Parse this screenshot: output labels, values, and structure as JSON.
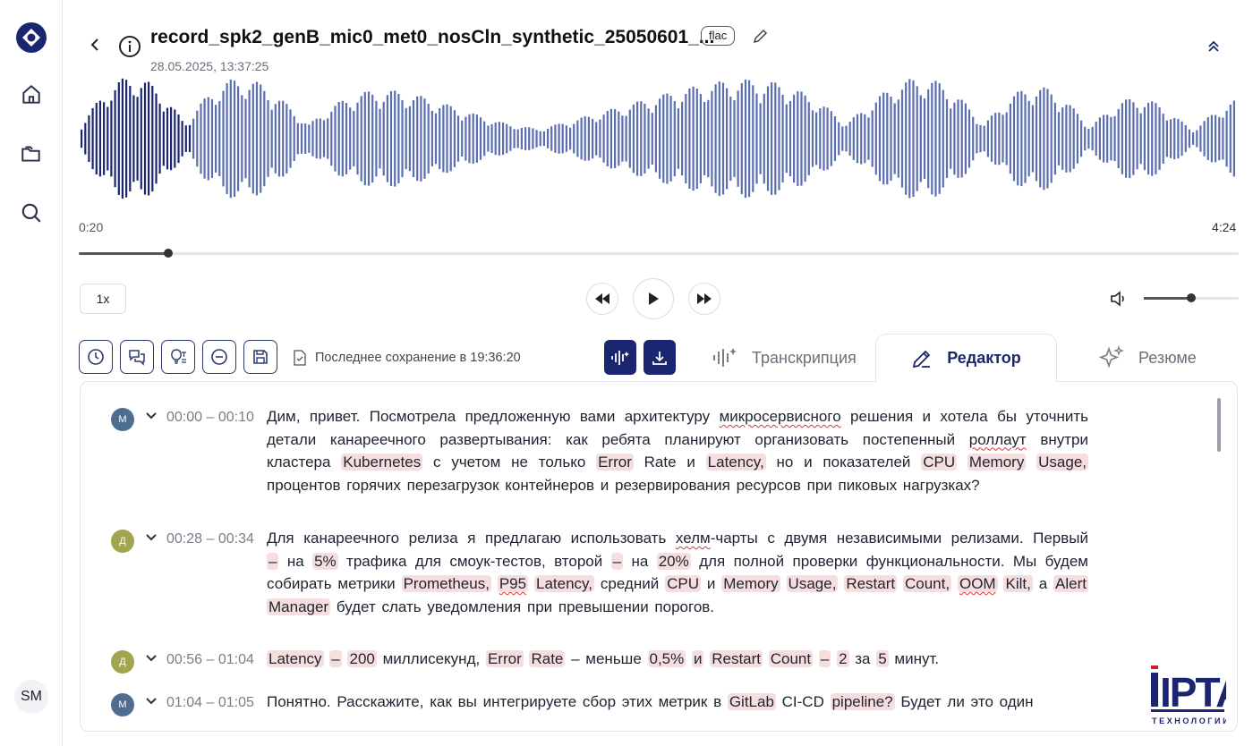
{
  "header": {
    "title": "record_spk2_genB_mic0_met0_nosCln_synthetic_25050601_...",
    "format_badge": "flac",
    "date": "28.05.2025, 13:37:25"
  },
  "sidebar": {
    "user_initials": "SM"
  },
  "player": {
    "current_time": "0:20",
    "total_time": "4:24",
    "progress_fraction": 0.077,
    "speed_label": "1x",
    "volume_fraction": 0.5
  },
  "toolbar": {
    "save_status": "Последнее сохранение в 19:36:20"
  },
  "tabs": [
    {
      "label": "Транскрипция"
    },
    {
      "label": "Редактор"
    },
    {
      "label": "Резюме"
    }
  ],
  "segments": [
    {
      "speaker": "М",
      "speaker_color": "#4f6d8f",
      "time": "00:00 – 00:10",
      "lines": [
        [
          {
            "t": "Дим, привет. Посмотрела предложенную вами архитектуру "
          },
          {
            "t": "микросервисного",
            "u": 1
          },
          {
            "t": " решения и хотела бы уточнить"
          }
        ],
        [
          {
            "t": "детали канареечного развертывания: как ребята планируют организовать постепенный "
          },
          {
            "t": "роллаут",
            "u": 1
          },
          {
            "t": " внутри"
          }
        ],
        [
          {
            "t": "кластера "
          },
          {
            "t": "Kubernetes",
            "h": 1
          },
          {
            "t": " с учетом не только "
          },
          {
            "t": "Error",
            "h": 1
          },
          {
            "t": " Rate и "
          },
          {
            "t": "Latency,",
            "h": 1
          },
          {
            "t": " но и показателей "
          },
          {
            "t": "CPU",
            "h": 1
          },
          {
            "t": " "
          },
          {
            "t": "Memory",
            "h": 1
          },
          {
            "t": " "
          },
          {
            "t": "Usage,",
            "h": 1
          }
        ],
        [
          {
            "t": "процентов горячих перезагрузок контейнеров и резервирования ресурсов при пиковых нагрузках?"
          }
        ]
      ]
    },
    {
      "speaker": "Д",
      "speaker_color": "#a3a44f",
      "time": "00:28 – 00:34",
      "lines": [
        [
          {
            "t": "Для канареечного релиза я предлагаю использовать "
          },
          {
            "t": "хелм",
            "u": 1
          },
          {
            "t": "-чарты с двумя независимыми релизами. Первый"
          }
        ],
        [
          {
            "t": "–",
            "h": 1
          },
          {
            "t": " на "
          },
          {
            "t": "5%",
            "h": 1
          },
          {
            "t": " трафика для смоук-тестов, второй "
          },
          {
            "t": "–",
            "h": 1
          },
          {
            "t": " на "
          },
          {
            "t": "20%",
            "h": 1
          },
          {
            "t": " для полной проверки функциональности. Мы будем"
          }
        ],
        [
          {
            "t": "собирать метрики "
          },
          {
            "t": "Prometheus,",
            "h": 1
          },
          {
            "t": " "
          },
          {
            "t": "P95",
            "h": 1,
            "u": 1
          },
          {
            "t": " "
          },
          {
            "t": "Latency,",
            "h": 1
          },
          {
            "t": " средний "
          },
          {
            "t": "CPU",
            "h": 1
          },
          {
            "t": " и "
          },
          {
            "t": "Memory",
            "h": 1
          },
          {
            "t": " "
          },
          {
            "t": "Usage,",
            "h": 1
          },
          {
            "t": " "
          },
          {
            "t": "Restart",
            "h": 1
          },
          {
            "t": " "
          },
          {
            "t": "Count,",
            "h": 1
          },
          {
            "t": " "
          },
          {
            "t": "OOM",
            "h": 1,
            "u": 1
          },
          {
            "t": " "
          },
          {
            "t": "Kilt,",
            "h": 1
          },
          {
            "t": " а "
          },
          {
            "t": "Alert",
            "h": 1
          }
        ],
        [
          {
            "t": "Manager",
            "h": 1
          },
          {
            "t": " будет слать уведомления при превышении порогов."
          }
        ]
      ]
    },
    {
      "speaker": "Д",
      "speaker_color": "#a3a44f",
      "time": "00:56 – 01:04",
      "lines": [
        [
          {
            "t": "Latency",
            "h": 1
          },
          {
            "t": " "
          },
          {
            "t": "–",
            "h": 1
          },
          {
            "t": " "
          },
          {
            "t": "200",
            "h": 1
          },
          {
            "t": " миллисекунд, "
          },
          {
            "t": "Error",
            "h": 1
          },
          {
            "t": " "
          },
          {
            "t": "Rate",
            "h": 1
          },
          {
            "t": " – меньше "
          },
          {
            "t": "0,5%",
            "h": 1
          },
          {
            "t": " "
          },
          {
            "t": "и",
            "h": 1
          },
          {
            "t": " "
          },
          {
            "t": "Restart",
            "h": 1
          },
          {
            "t": " "
          },
          {
            "t": "Count",
            "h": 1
          },
          {
            "t": " "
          },
          {
            "t": "–",
            "h": 1
          },
          {
            "t": " "
          },
          {
            "t": "2",
            "h": 1
          },
          {
            "t": " за "
          },
          {
            "t": "5",
            "h": 1
          },
          {
            "t": " минут."
          }
        ]
      ]
    },
    {
      "speaker": "М",
      "speaker_color": "#4f6d8f",
      "time": "01:04 – 01:05",
      "lines": [
        [
          {
            "t": "Понятно. Расскажите, как вы интегрируете сбор этих метрик в "
          },
          {
            "t": "GitLab",
            "h": 1
          },
          {
            "t": " CI-CD "
          },
          {
            "t": "pipeline?",
            "h": 1
          },
          {
            "t": " Будет ли это один"
          }
        ]
      ]
    }
  ],
  "logo": {
    "word": "IPTA",
    "tagline": "ТЕХНОЛОГИИ"
  }
}
